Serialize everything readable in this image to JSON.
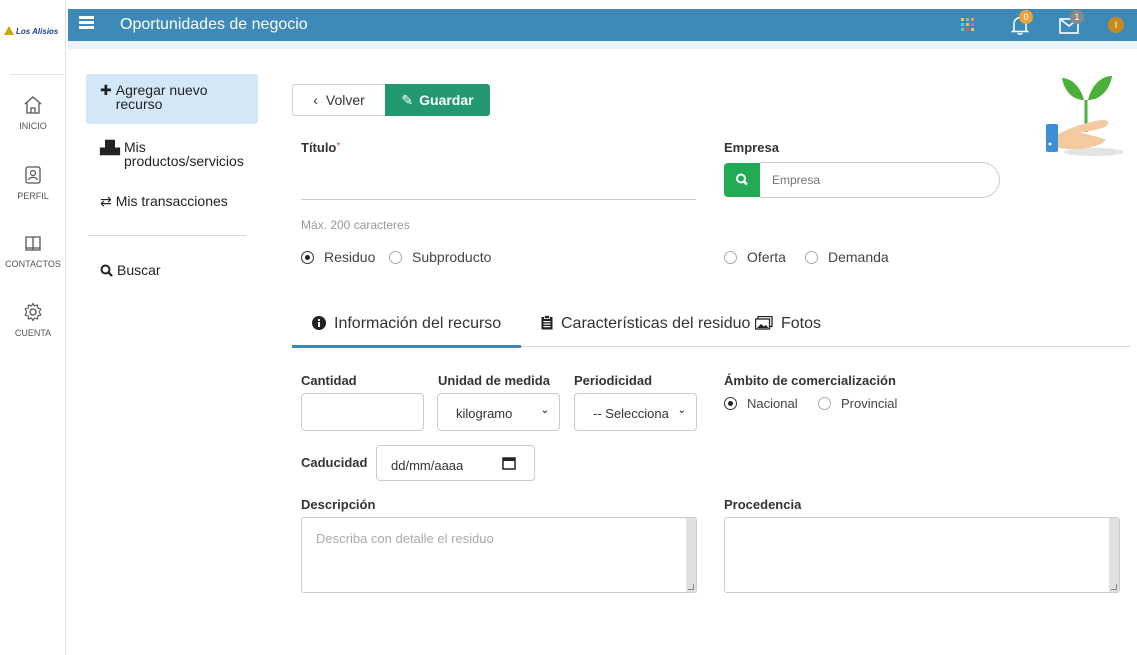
{
  "app": {
    "logo_text": "Los Alisios",
    "title": "Oportunidades de negocio"
  },
  "topbar": {
    "notifications_count": "0",
    "messages_count": "1",
    "avatar_initial": "I"
  },
  "rail": {
    "items": [
      {
        "label": "INICIO",
        "icon": "home-icon"
      },
      {
        "label": "PERFIL",
        "icon": "profile-icon"
      },
      {
        "label": "CONTACTOS",
        "icon": "contacts-book-icon"
      },
      {
        "label": "CUENTA",
        "icon": "gear-icon"
      }
    ]
  },
  "sidebar": {
    "add_new": "Agregar nuevo recurso",
    "my_products": "Mis productos/servicios",
    "my_transactions": "Mis transacciones",
    "search": "Buscar"
  },
  "actions": {
    "back": "Volver",
    "save": "Guardar"
  },
  "form": {
    "title_label": "Título",
    "title_required": "*",
    "title_help": "Máx. 200 caracteres",
    "empresa_label": "Empresa",
    "empresa_placeholder": "Empresa",
    "type_options": [
      "Residuo",
      "Subproducto"
    ],
    "type_selected": "Residuo",
    "offer_options": [
      "Oferta",
      "Demanda"
    ],
    "offer_selected": ""
  },
  "tabs": [
    {
      "label": "Información del recurso",
      "active": true
    },
    {
      "label": "Características del residuo",
      "active": false
    },
    {
      "label": "Fotos",
      "active": false
    }
  ],
  "details": {
    "cantidad_label": "Cantidad",
    "unidad_label": "Unidad de medida",
    "unidad_value": "kilogramo",
    "periodicidad_label": "Periodicidad",
    "periodicidad_value": "-- Selecciona",
    "ambito_label": "Ámbito de comercialización",
    "ambito_options": [
      "Nacional",
      "Provincial"
    ],
    "ambito_selected": "Nacional",
    "caducidad_label": "Caducidad",
    "caducidad_placeholder": "dd/mm/aaaa",
    "descripcion_label": "Descripción",
    "descripcion_placeholder": "Describa con detalle el residuo",
    "procedencia_label": "Procedencia"
  },
  "colors": {
    "topbar": "#3d8ab8",
    "save_button": "#22996e",
    "search_button": "#22aa55",
    "sidebar_active": "#d4e7f7"
  }
}
